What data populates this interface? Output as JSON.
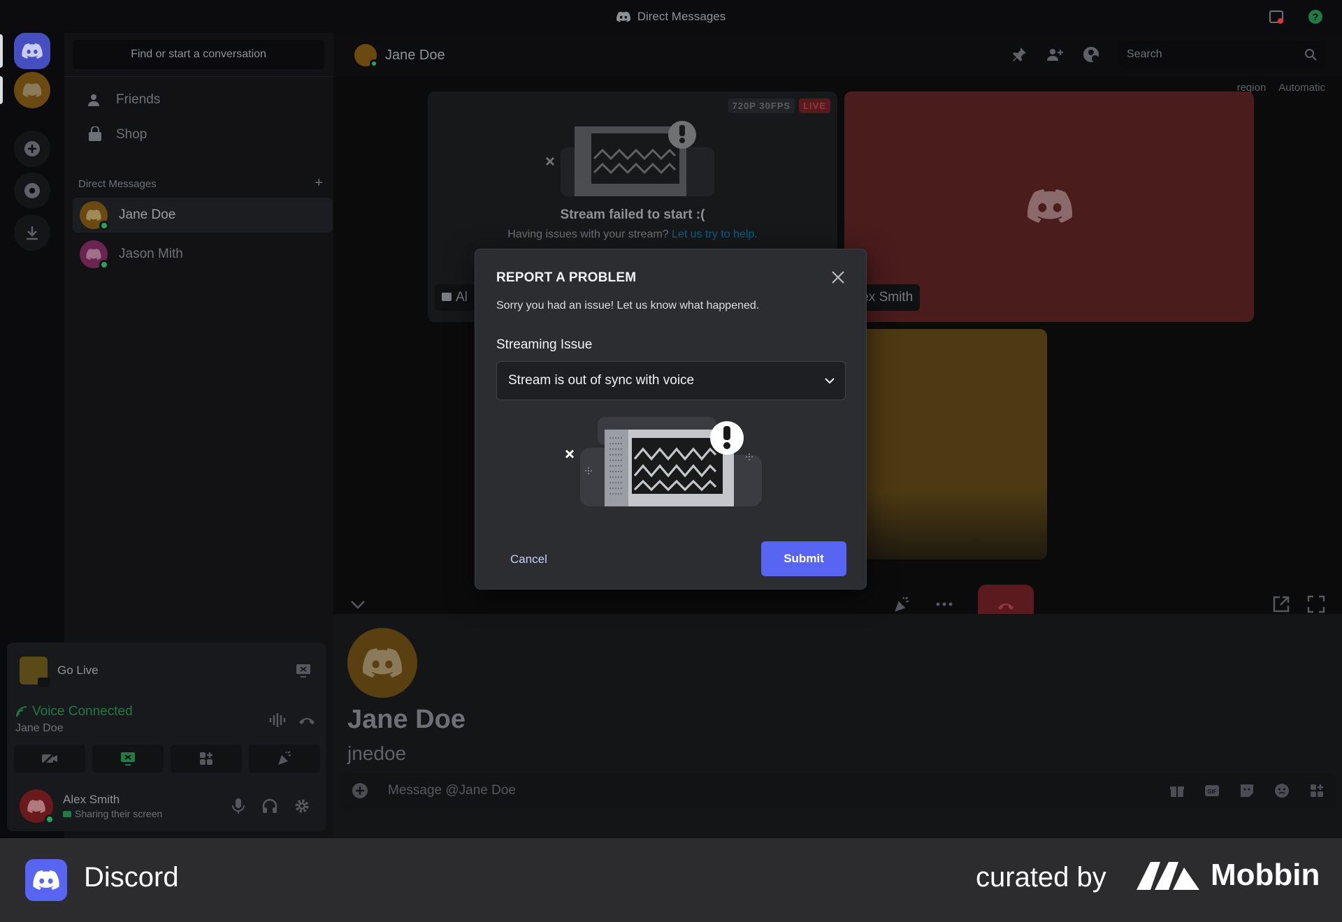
{
  "titlebar": {
    "title": "Direct Messages"
  },
  "sidebar": {
    "search_placeholder": "Find or start a conversation",
    "nav": [
      {
        "label": "Friends",
        "icon": "friends-icon"
      },
      {
        "label": "Shop",
        "icon": "shop-icon"
      }
    ],
    "dm_header": "Direct Messages",
    "dms": [
      {
        "name": "Jane Doe",
        "color": "#f0b232",
        "status": "online",
        "selected": true
      },
      {
        "name": "Jason Mith",
        "color": "#eb459e",
        "status": "online",
        "selected": false
      }
    ]
  },
  "voice_panel": {
    "go_live": "Go Live",
    "status": "Voice Connected",
    "channel": "Jane Doe",
    "user": {
      "name": "Alex Smith",
      "status": "Sharing their screen"
    }
  },
  "chat": {
    "recipient": "Jane Doe",
    "search_placeholder": "Search",
    "region_label": "region",
    "region_value": "Automatic",
    "stream": {
      "quality": "720P 30FPS",
      "live": "LIVE",
      "failed_title": "Stream failed to start :(",
      "failed_text": "Having issues with your stream?",
      "failed_link": "Let us try to help.",
      "chip_left": "Al",
      "chip_right": "lex Smith"
    },
    "profile": {
      "name": "Jane Doe",
      "username": "jnedoe"
    },
    "message_placeholder": "Message @Jane Doe"
  },
  "modal": {
    "title": "REPORT A PROBLEM",
    "subtitle": "Sorry you had an issue! Let us know what happened.",
    "field_label": "Streaming Issue",
    "selected_option": "Stream is out of sync with voice",
    "cancel": "Cancel",
    "submit": "Submit"
  },
  "footer": {
    "app": "Discord",
    "curated": "curated by",
    "brand": "Mobbin"
  },
  "colors": {
    "accent": "#5865f2",
    "online": "#23a55a",
    "danger": "#da373c",
    "link": "#00a8fc"
  }
}
